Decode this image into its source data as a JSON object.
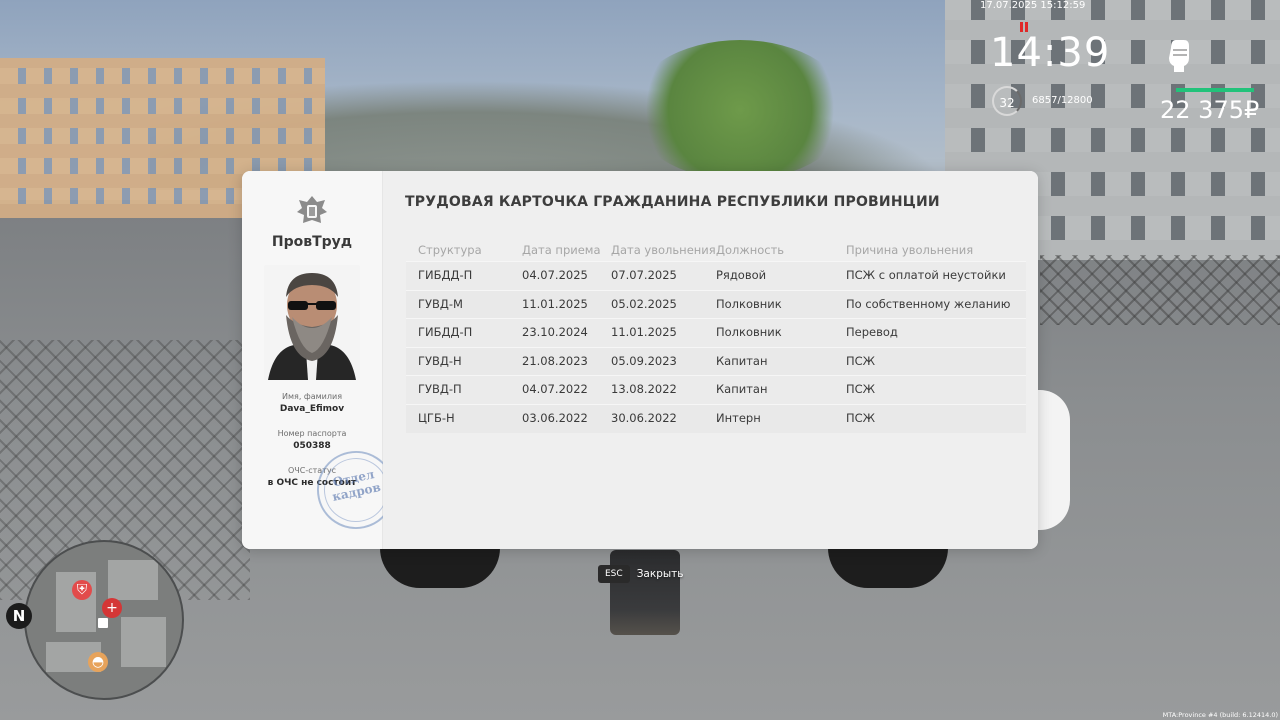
{
  "hud": {
    "datetime": "17.07.2025 15:12:59",
    "clock": "14:39",
    "level": "32",
    "xp": "6857/12800",
    "money": "22 375₽",
    "icons": [
      "fist-icon",
      "level-ring-icon"
    ],
    "health_color": "#22c27a"
  },
  "card": {
    "title": "ТРУДОВАЯ КАРТОЧКА ГРАЖДАНИНА РЕСПУБЛИКИ ПРОВИНЦИИ",
    "brand": "ПровТруд",
    "emblem_icon": "coat-of-arms-icon",
    "name_label": "Имя, фамилия",
    "name_value": "Dava_Efimov",
    "passport_label": "Номер паспорта",
    "passport_value": "050388",
    "status_label": "ОЧС-статус",
    "status_value": "в ОЧС не состоит",
    "stamp_text": "Отдел кадров",
    "columns": [
      "Структура",
      "Дата приема",
      "Дата увольнения",
      "Должность",
      "Причина увольнения"
    ],
    "rows": [
      [
        "ГИБДД-П",
        "04.07.2025",
        "07.07.2025",
        "Рядовой",
        "ПСЖ с оплатой неустойки"
      ],
      [
        "ГУВД-М",
        "11.01.2025",
        "05.02.2025",
        "Полковник",
        "По собственному желанию"
      ],
      [
        "ГИБДД-П",
        "23.10.2024",
        "11.01.2025",
        "Полковник",
        "Перевод"
      ],
      [
        "ГУВД-Н",
        "21.08.2023",
        "05.09.2023",
        "Капитан",
        "ПСЖ"
      ],
      [
        "ГУВД-П",
        "04.07.2022",
        "13.08.2022",
        "Капитан",
        "ПСЖ"
      ],
      [
        "ЦГБ-Н",
        "03.06.2022",
        "30.06.2022",
        "Интерн",
        "ПСЖ"
      ]
    ]
  },
  "close_hint": {
    "key": "ESC",
    "label": "Закрыть"
  },
  "minimap": {
    "compass": "N",
    "icons": [
      "hospital-icon",
      "police-icon",
      "food-icon",
      "player-marker-icon"
    ]
  },
  "footer": {
    "build": "MTA:Province #4 (build: 6.12414.0)"
  }
}
